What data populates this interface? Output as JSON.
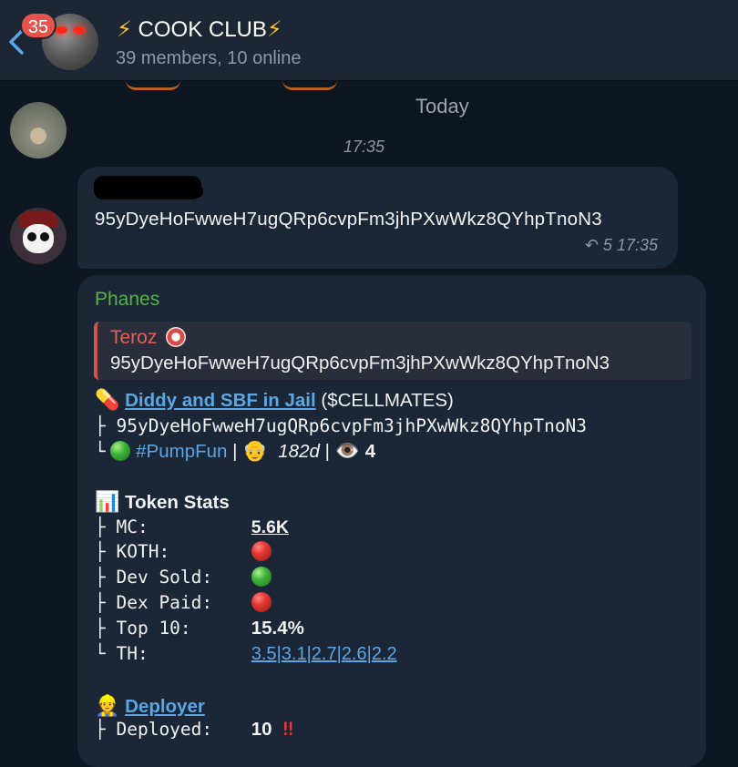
{
  "header": {
    "unread_count": "35",
    "title_bolt_left": "⚡",
    "title": " COOK CLUB",
    "title_bolt_right": "⚡",
    "subtitle": "39 members, 10 online"
  },
  "feed": {
    "date": "Today",
    "time": "17:35"
  },
  "message1": {
    "text": "95yDyeHoFwweH7ugQRp6cvpFm3jhPXwWkz8QYhpTnoN3",
    "forwards": "5",
    "time": "17:35"
  },
  "message2": {
    "sender": "Phanes",
    "reply_name": "Teroz",
    "reply_text": "95yDyeHoFwweH7ugQRp6cvpFm3jhPXwWkz8QYhpTnoN3",
    "token_name": "Diddy and SBF in Jail",
    "token_ticker": " ($CELLMATES)",
    "token_address": "├ 95yDyeHoFwweH7ugQRp6cvpFm3jhPXwWkz8QYhpTnoN3",
    "tree_end": "└",
    "platform_tag": "#PumpFun",
    "sep": " | ",
    "age": "182d",
    "views": "4",
    "stats_title": "Token Stats",
    "stats": {
      "mc_label": "├ MC:",
      "mc_value": "5.6K",
      "koth_label": "├ KOTH:",
      "dev_sold_label": "├ Dev Sold:",
      "dex_paid_label": "├ Dex Paid:",
      "top10_label": "├ Top 10:",
      "top10_value": "15.4%",
      "th_label": "└ TH:",
      "th_values": [
        "3.5",
        "3.1",
        "2.7",
        "2.6",
        "2.2"
      ],
      "th_sep": "|"
    },
    "deployer_title": "Deployer",
    "deployed_label": "├ Deployed:",
    "deployed_value": "10",
    "deployed_mark": "‼"
  },
  "colors": {
    "background": "#0e1621",
    "bubble": "#1b2636",
    "link": "#5ba7e6",
    "sender_name": "#56b14a",
    "reply_accent": "#d2534b",
    "badge": "#e5534b"
  }
}
